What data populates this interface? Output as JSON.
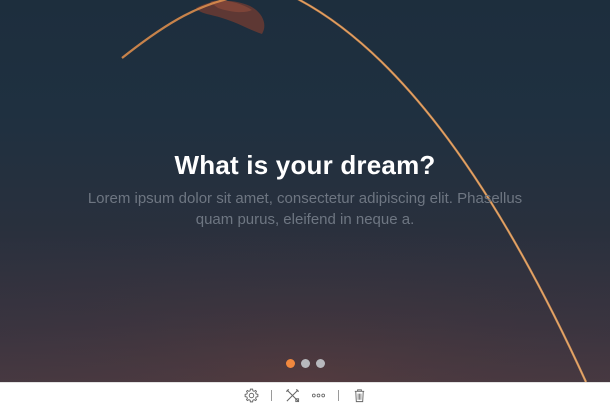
{
  "slide": {
    "title": "What is your dream?",
    "subtitle": "Lorem ipsum dolor sit amet, consectetur adipiscing elit. Phasellus quam purus, eleifend in neque a."
  },
  "pagination": {
    "count": 3,
    "active_index": 0,
    "active_color": "#f0883e",
    "inactive_color": "#b7b9bd"
  },
  "toolbar": {
    "icons": [
      "gear-icon",
      "crossed-tools-icon",
      "more-icon",
      "trash-icon"
    ]
  }
}
